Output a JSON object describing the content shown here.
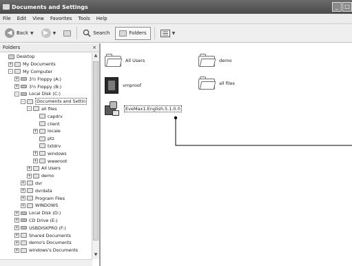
{
  "window": {
    "title": "Documents and Settings"
  },
  "menu": [
    "File",
    "Edit",
    "View",
    "Favorites",
    "Tools",
    "Help"
  ],
  "toolbar": {
    "back_label": "Back",
    "search_label": "Search",
    "folders_label": "Folders"
  },
  "folders_pane": {
    "header": "Folders",
    "close_symbol": "×"
  },
  "tree": [
    {
      "label": "Desktop",
      "indent": 0,
      "exp": "",
      "icon": "desk"
    },
    {
      "label": "My Documents",
      "indent": 1,
      "exp": "+",
      "icon": "folder"
    },
    {
      "label": "My Computer",
      "indent": 1,
      "exp": "-",
      "icon": "folder"
    },
    {
      "label": "3½ Floppy (A:)",
      "indent": 2,
      "exp": "+",
      "icon": "drive"
    },
    {
      "label": "3½ Floppy (B:)",
      "indent": 2,
      "exp": "+",
      "icon": "drive"
    },
    {
      "label": "Local Disk (C:)",
      "indent": 2,
      "exp": "-",
      "icon": "drive"
    },
    {
      "label": "Documents and Settin",
      "indent": 3,
      "exp": "-",
      "icon": "folder",
      "selected": true
    },
    {
      "label": "all files",
      "indent": 4,
      "exp": "-",
      "icon": "folder"
    },
    {
      "label": "capdrv",
      "indent": 5,
      "exp": "",
      "icon": "folder"
    },
    {
      "label": "client",
      "indent": 5,
      "exp": "",
      "icon": "folder"
    },
    {
      "label": "locale",
      "indent": 5,
      "exp": "+",
      "icon": "folder"
    },
    {
      "label": "ptz",
      "indent": 5,
      "exp": "",
      "icon": "folder"
    },
    {
      "label": "txtdrv",
      "indent": 5,
      "exp": "",
      "icon": "folder"
    },
    {
      "label": "windows",
      "indent": 5,
      "exp": "+",
      "icon": "folder"
    },
    {
      "label": "wwwroot",
      "indent": 5,
      "exp": "+",
      "icon": "folder"
    },
    {
      "label": "All Users",
      "indent": 4,
      "exp": "+",
      "icon": "folder"
    },
    {
      "label": "demo",
      "indent": 4,
      "exp": "+",
      "icon": "folder"
    },
    {
      "label": "dvr",
      "indent": 3,
      "exp": "+",
      "icon": "folder"
    },
    {
      "label": "dvrdata",
      "indent": 3,
      "exp": "+",
      "icon": "folder"
    },
    {
      "label": "Program Files",
      "indent": 3,
      "exp": "+",
      "icon": "folder"
    },
    {
      "label": "WINDOWS",
      "indent": 3,
      "exp": "+",
      "icon": "folder"
    },
    {
      "label": "Local Disk (D:)",
      "indent": 2,
      "exp": "+",
      "icon": "drive"
    },
    {
      "label": "CD Drive (E:)",
      "indent": 2,
      "exp": "+",
      "icon": "drive"
    },
    {
      "label": "USBDISKPRO (F:)",
      "indent": 2,
      "exp": "+",
      "icon": "drive"
    },
    {
      "label": "Shared Documents",
      "indent": 2,
      "exp": "+",
      "icon": "folder"
    },
    {
      "label": "demo's Documents",
      "indent": 2,
      "exp": "+",
      "icon": "folder"
    },
    {
      "label": "windows's Documents",
      "indent": 2,
      "exp": "+",
      "icon": "folder"
    }
  ],
  "files": {
    "all_users": "All Users",
    "demo": "demo",
    "vmproof": "vmproof",
    "all_files": "all files",
    "installer": "EveMax1.English.5.1.0.0"
  }
}
